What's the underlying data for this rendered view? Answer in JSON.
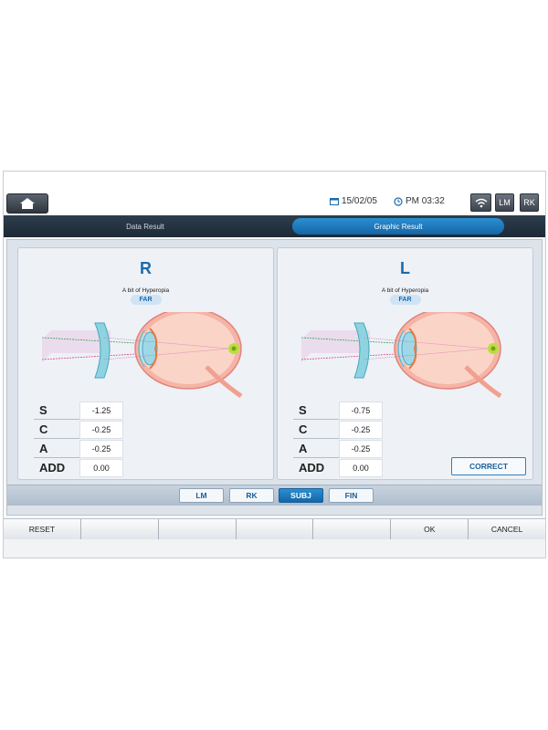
{
  "header": {
    "date": "15/02/05",
    "time": "PM 03:32",
    "icons": {
      "home": "home-icon",
      "calendar": "calendar-icon",
      "clock": "clock-icon",
      "wifi": "wifi-icon"
    },
    "lm_label": "LM",
    "rk_label": "RK"
  },
  "tabs": [
    {
      "label": "Data Result",
      "active": false
    },
    {
      "label": "Graphic Result",
      "active": true
    }
  ],
  "right_eye": {
    "label": "R",
    "diagnosis": "A bit of Hyperopia",
    "status": "FAR",
    "measurements": [
      {
        "label": "S",
        "value": "-1.25"
      },
      {
        "label": "C",
        "value": "-0.25"
      },
      {
        "label": "A",
        "value": "-0.25"
      },
      {
        "label": "ADD",
        "value": "0.00"
      }
    ]
  },
  "left_eye": {
    "label": "L",
    "diagnosis": "A bit of Hyperopia",
    "status": "FAR",
    "measurements": [
      {
        "label": "S",
        "value": "-0.75"
      },
      {
        "label": "C",
        "value": "-0.25"
      },
      {
        "label": "A",
        "value": "-0.25"
      },
      {
        "label": "ADD",
        "value": "0.00"
      }
    ],
    "correct_label": "CORRECT"
  },
  "modes": [
    {
      "label": "LM",
      "active": false
    },
    {
      "label": "RK",
      "active": false
    },
    {
      "label": "SUBJ",
      "active": true
    },
    {
      "label": "FIN",
      "active": false
    }
  ],
  "bottom_buttons": [
    "RESET",
    "",
    "",
    "",
    "",
    "OK",
    "CANCEL"
  ],
  "colors": {
    "accent": "#1a6aad",
    "tab_bar": "#22313f",
    "active_tab": "#1f7cc0"
  }
}
